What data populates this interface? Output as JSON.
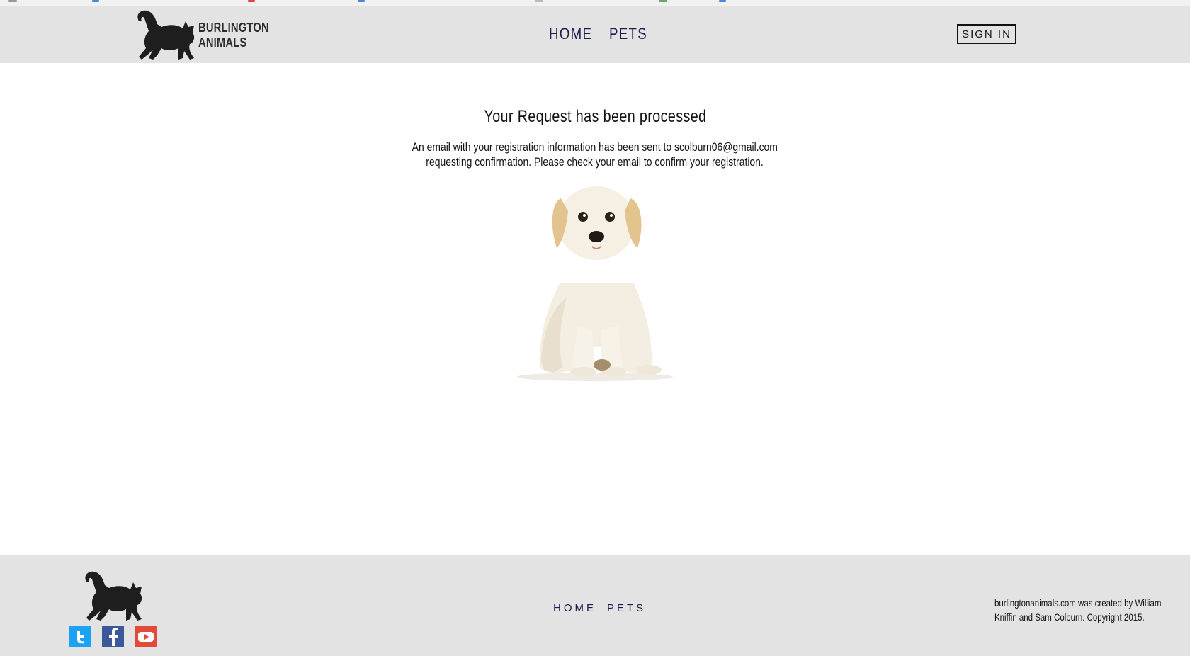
{
  "header": {
    "logo_line1": "BURLINGTON",
    "logo_line2": "ANIMALS",
    "nav_home": "HOME",
    "nav_pets": "PETS",
    "signin_label": "SIGN IN"
  },
  "main": {
    "title": "Your Request has been processed",
    "message_line1": "An email with your registration information has been sent to scolburn06@gmail.com",
    "message_line2": "requesting confirmation. Please check your email to confirm your registration.",
    "image": "puppy-photo"
  },
  "footer": {
    "nav_home": "HOME",
    "nav_pets": "PETS",
    "credit_line1": "burlingtonanimals.com was created by William",
    "credit_line2": "Kniffin and Sam Colburn. Copyright 2015.",
    "social": [
      "twitter-icon",
      "facebook-icon",
      "youtube-icon"
    ]
  },
  "colors": {
    "header_bg": "#e3e3e3",
    "nav_text": "#1c1c4d",
    "twitter": "#1da1f2",
    "facebook": "#3b5998",
    "youtube": "#e24a3a"
  }
}
